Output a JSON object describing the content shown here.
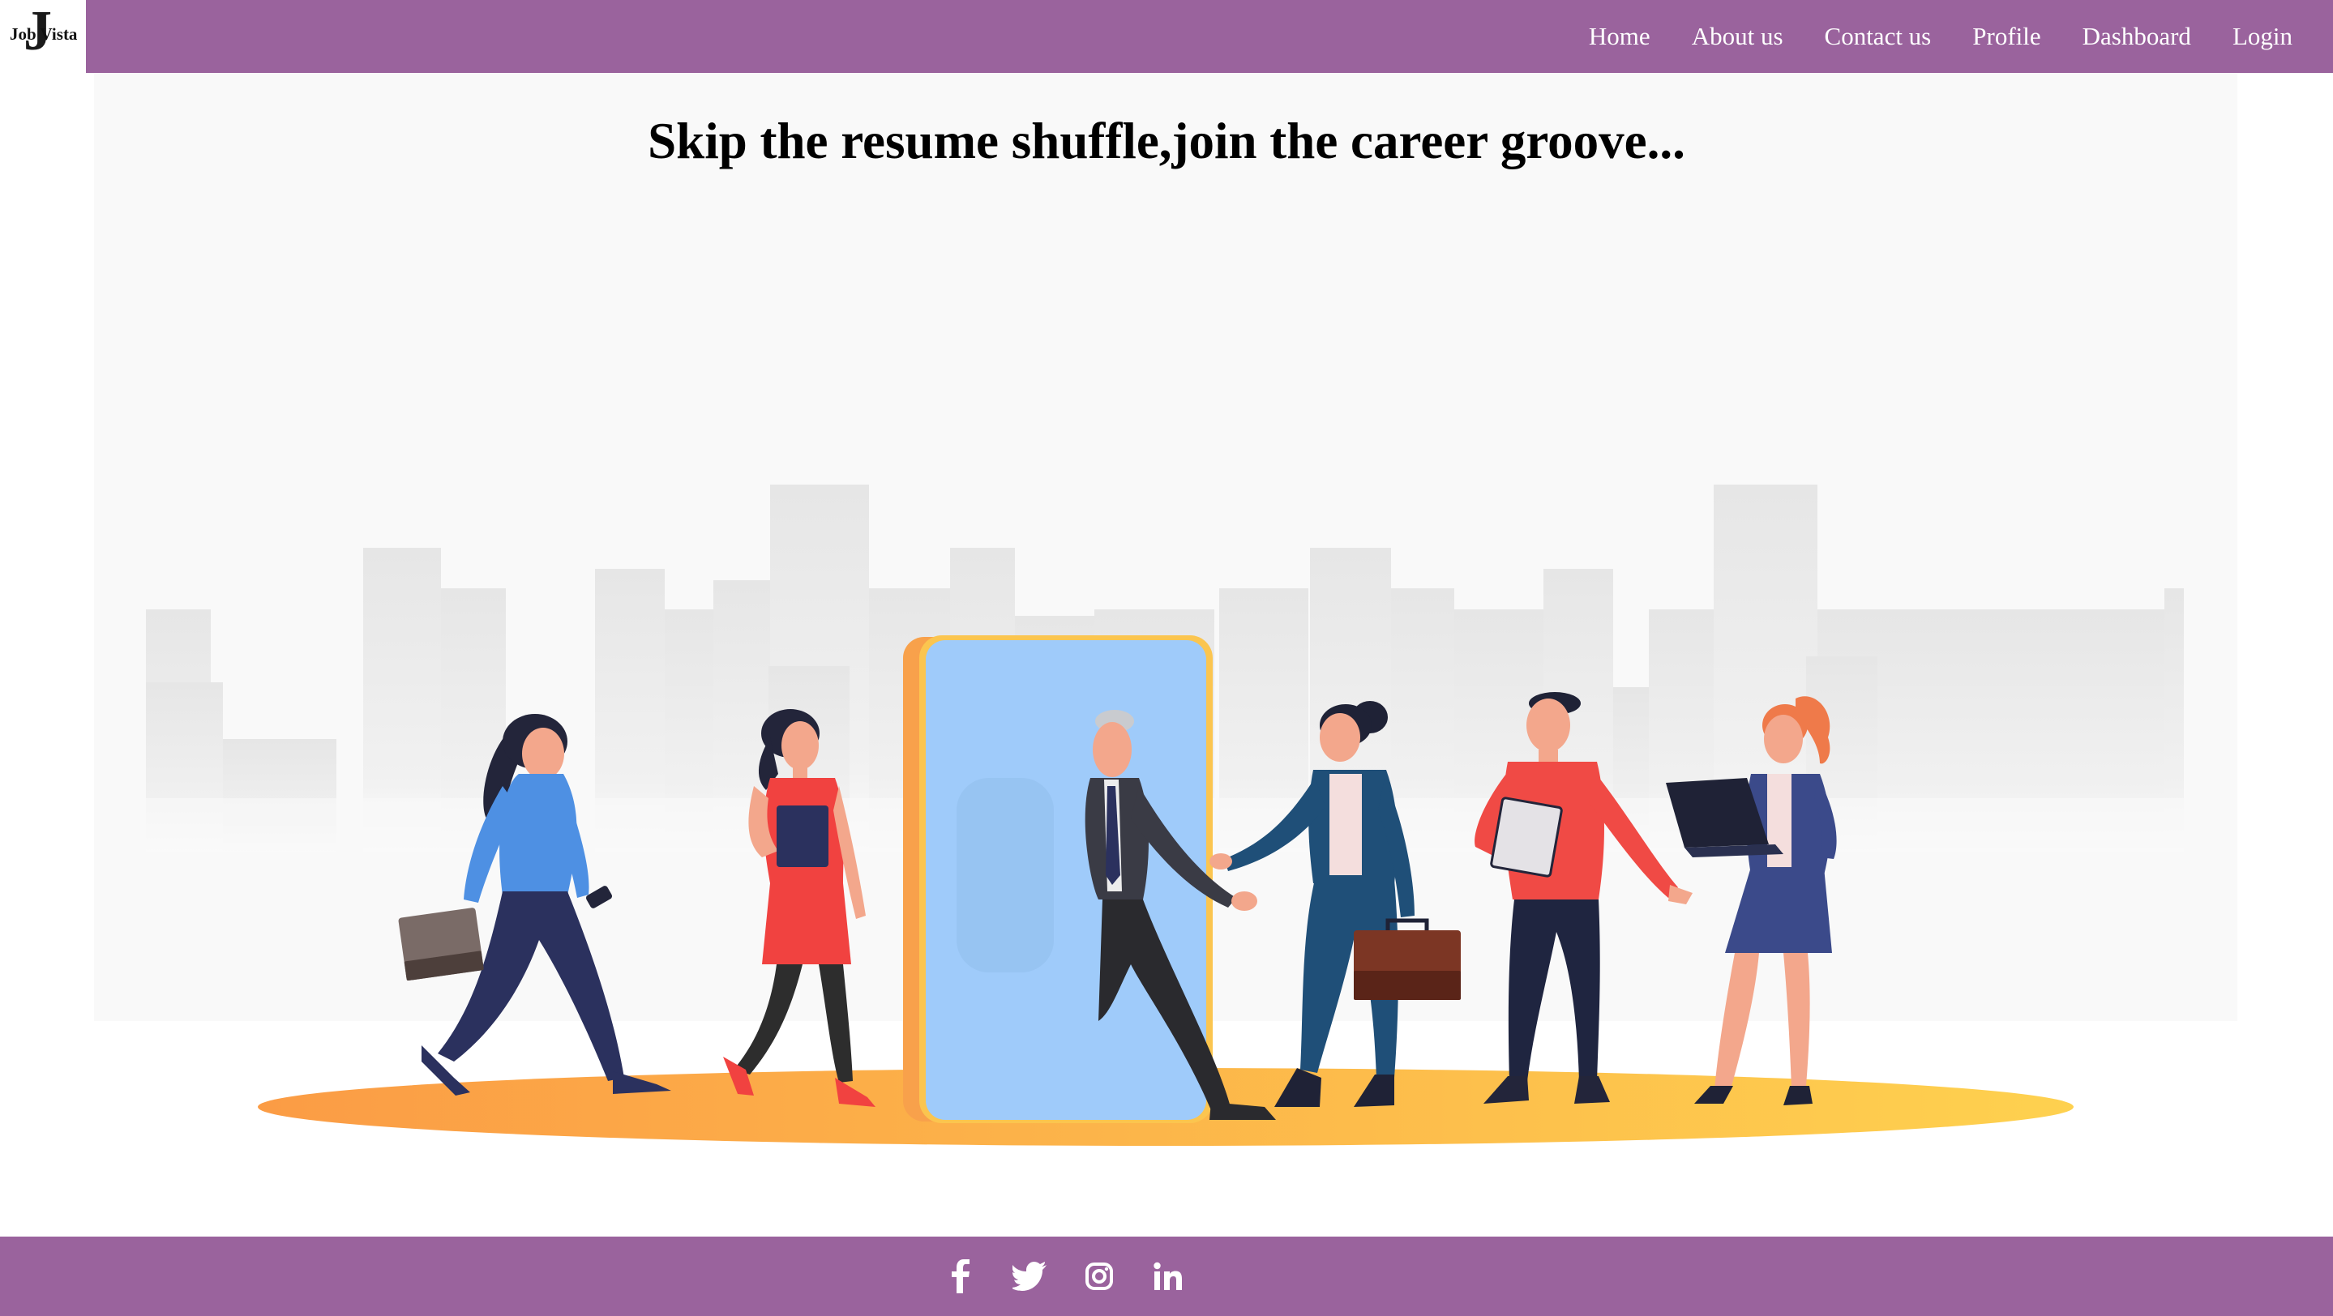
{
  "logo": {
    "letter": "J",
    "text": "Job Vista"
  },
  "nav": {
    "items": [
      {
        "label": "Home"
      },
      {
        "label": "About us"
      },
      {
        "label": "Contact us"
      },
      {
        "label": "Profile"
      },
      {
        "label": "Dashboard"
      },
      {
        "label": "Login"
      }
    ]
  },
  "hero": {
    "headline": "Skip the resume shuffle,join the career groove..."
  },
  "footer": {
    "social": [
      {
        "icon": "facebook-icon"
      },
      {
        "icon": "twitter-icon"
      },
      {
        "icon": "instagram-icon"
      },
      {
        "icon": "linkedin-icon"
      }
    ]
  },
  "colors": {
    "brand": "#9a639d",
    "hero_bg": "#f9f9f9",
    "text": "#000000"
  }
}
